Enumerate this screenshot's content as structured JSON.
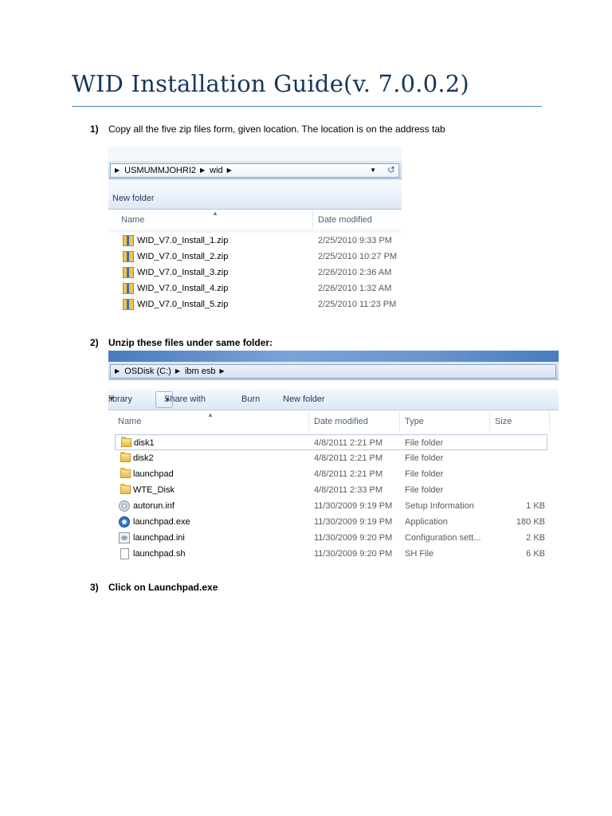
{
  "document": {
    "title": "WID Installation Guide(v. 7.0.0.2)"
  },
  "steps": [
    {
      "number": "1)",
      "text": "Copy all the five zip files form, given location. The location is on the address tab"
    },
    {
      "number": "2)",
      "text": "Unzip these files under same folder:"
    },
    {
      "number": "3)",
      "text": "Click on Launchpad.exe"
    }
  ],
  "explorer1": {
    "breadcrumb": [
      "USMUMMJOHRI2",
      "wid"
    ],
    "toolbar": {
      "new_folder": "New folder"
    },
    "columns": {
      "name": "Name",
      "date_modified": "Date modified"
    },
    "files": [
      {
        "name": "WID_V7.0_Install_1.zip",
        "date": "2/25/2010 9:33 PM",
        "icon": "zip-archive-icon"
      },
      {
        "name": "WID_V7.0_Install_2.zip",
        "date": "2/25/2010 10:27 PM",
        "icon": "zip-archive-icon"
      },
      {
        "name": "WID_V7.0_Install_3.zip",
        "date": "2/26/2010 2:36 AM",
        "icon": "zip-archive-icon"
      },
      {
        "name": "WID_V7.0_Install_4.zip",
        "date": "2/26/2010 1:32 AM",
        "icon": "zip-archive-icon"
      },
      {
        "name": "WID_V7.0_Install_5.zip",
        "date": "2/25/2010 11:23 PM",
        "icon": "zip-archive-icon"
      }
    ]
  },
  "explorer2": {
    "breadcrumb": [
      "OSDisk (C:)",
      "ibm esb"
    ],
    "toolbar": {
      "library": "library",
      "share_with": "Share with",
      "burn": "Burn",
      "new_folder": "New folder"
    },
    "columns": {
      "name": "Name",
      "date_modified": "Date modified",
      "type": "Type",
      "size": "Size"
    },
    "files": [
      {
        "name": "disk1",
        "date": "4/8/2011 2:21 PM",
        "type": "File folder",
        "size": "",
        "icon": "folder-icon"
      },
      {
        "name": "disk2",
        "date": "4/8/2011 2:21 PM",
        "type": "File folder",
        "size": "",
        "icon": "folder-icon"
      },
      {
        "name": "launchpad",
        "date": "4/8/2011 2:21 PM",
        "type": "File folder",
        "size": "",
        "icon": "folder-icon"
      },
      {
        "name": "WTE_Disk",
        "date": "4/8/2011 2:33 PM",
        "type": "File folder",
        "size": "",
        "icon": "folder-icon"
      },
      {
        "name": "autorun.inf",
        "date": "11/30/2009 9:19 PM",
        "type": "Setup Information",
        "size": "1 KB",
        "icon": "setup-info-icon"
      },
      {
        "name": "launchpad.exe",
        "date": "11/30/2009 9:19 PM",
        "type": "Application",
        "size": "180 KB",
        "icon": "application-icon"
      },
      {
        "name": "launchpad.ini",
        "date": "11/30/2009 9:20 PM",
        "type": "Configuration sett...",
        "size": "2 KB",
        "icon": "config-file-icon"
      },
      {
        "name": "launchpad.sh",
        "date": "11/30/2009 9:20 PM",
        "type": "SH File",
        "size": "6 KB",
        "icon": "file-icon"
      }
    ]
  }
}
